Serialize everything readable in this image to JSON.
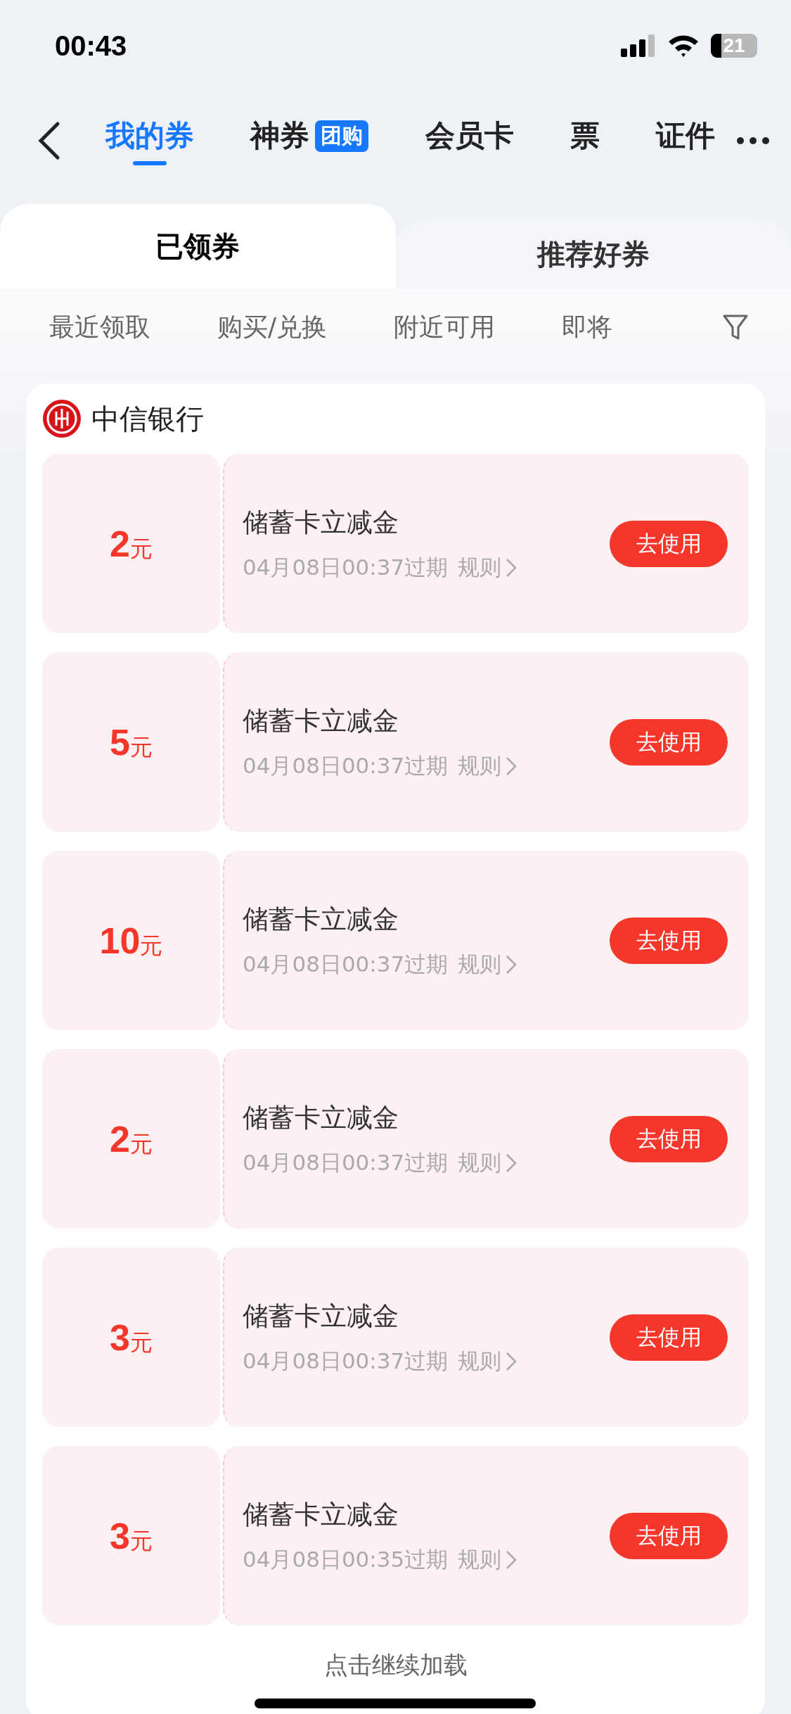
{
  "status_bar": {
    "time": "00:43",
    "battery": "21"
  },
  "nav": {
    "tabs": [
      {
        "label": "我的券",
        "selected": true
      },
      {
        "label": "神券",
        "badge": "团购",
        "selected": false
      },
      {
        "label": "会员卡",
        "selected": false
      },
      {
        "label": "票",
        "selected": false
      },
      {
        "label": "证件",
        "selected": false
      }
    ]
  },
  "segments": [
    {
      "label": "已领券",
      "selected": true
    },
    {
      "label": "推荐好券",
      "selected": false
    }
  ],
  "filters": [
    {
      "label": "最近领取",
      "selected": false
    },
    {
      "label": "购买/兑换",
      "selected": false
    },
    {
      "label": "附近可用",
      "selected": false
    },
    {
      "label": "即将",
      "selected": false
    }
  ],
  "merchant": {
    "name": "中信银行"
  },
  "coupons": [
    {
      "amount": "2",
      "unit": "元",
      "title": "储蓄卡立减金",
      "expiry": "04月08日00:37过期",
      "rules": "规则",
      "button": "去使用"
    },
    {
      "amount": "5",
      "unit": "元",
      "title": "储蓄卡立减金",
      "expiry": "04月08日00:37过期",
      "rules": "规则",
      "button": "去使用"
    },
    {
      "amount": "10",
      "unit": "元",
      "title": "储蓄卡立减金",
      "expiry": "04月08日00:37过期",
      "rules": "规则",
      "button": "去使用"
    },
    {
      "amount": "2",
      "unit": "元",
      "title": "储蓄卡立减金",
      "expiry": "04月08日00:37过期",
      "rules": "规则",
      "button": "去使用"
    },
    {
      "amount": "3",
      "unit": "元",
      "title": "储蓄卡立减金",
      "expiry": "04月08日00:37过期",
      "rules": "规则",
      "button": "去使用"
    },
    {
      "amount": "3",
      "unit": "元",
      "title": "储蓄卡立减金",
      "expiry": "04月08日00:35过期",
      "rules": "规则",
      "button": "去使用"
    }
  ],
  "load_more": "点击继续加载"
}
